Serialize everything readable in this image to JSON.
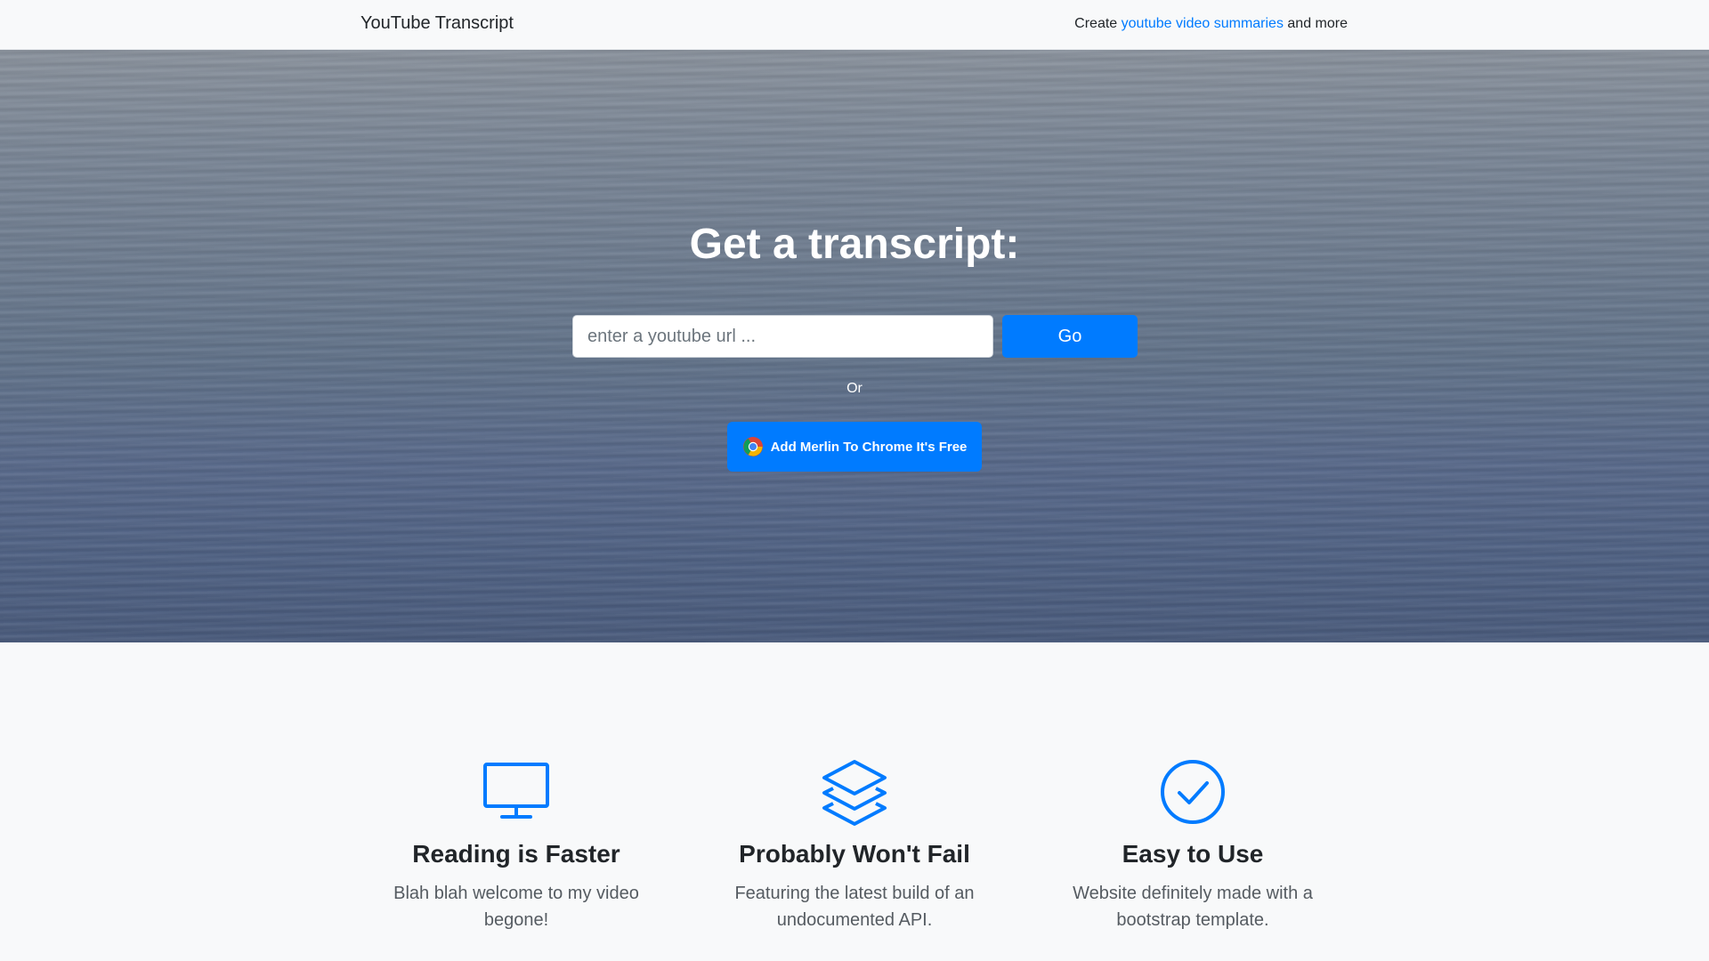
{
  "navbar": {
    "brand": "YouTube Transcript",
    "right_prefix": "Create ",
    "right_link": "youtube video summaries",
    "right_suffix": " and more"
  },
  "hero": {
    "title": "Get a transcript:",
    "input_placeholder": "enter a youtube url ...",
    "go_label": "Go",
    "or_label": "Or",
    "chrome_button_label": "Add Merlin To Chrome It's Free",
    "chrome_icon": "chrome-icon"
  },
  "features": [
    {
      "icon": "monitor-icon",
      "title": "Reading is Faster",
      "text": "Blah blah welcome to my video begone!"
    },
    {
      "icon": "layers-icon",
      "title": "Probably Won't Fail",
      "text": "Featuring the latest build of an undocumented API."
    },
    {
      "icon": "check-circle-icon",
      "title": "Easy to Use",
      "text": "Website definitely made with a bootstrap template."
    }
  ],
  "colors": {
    "accent": "#007bff",
    "text": "#212529",
    "muted": "#6c757d",
    "background": "#f8f9fa"
  }
}
